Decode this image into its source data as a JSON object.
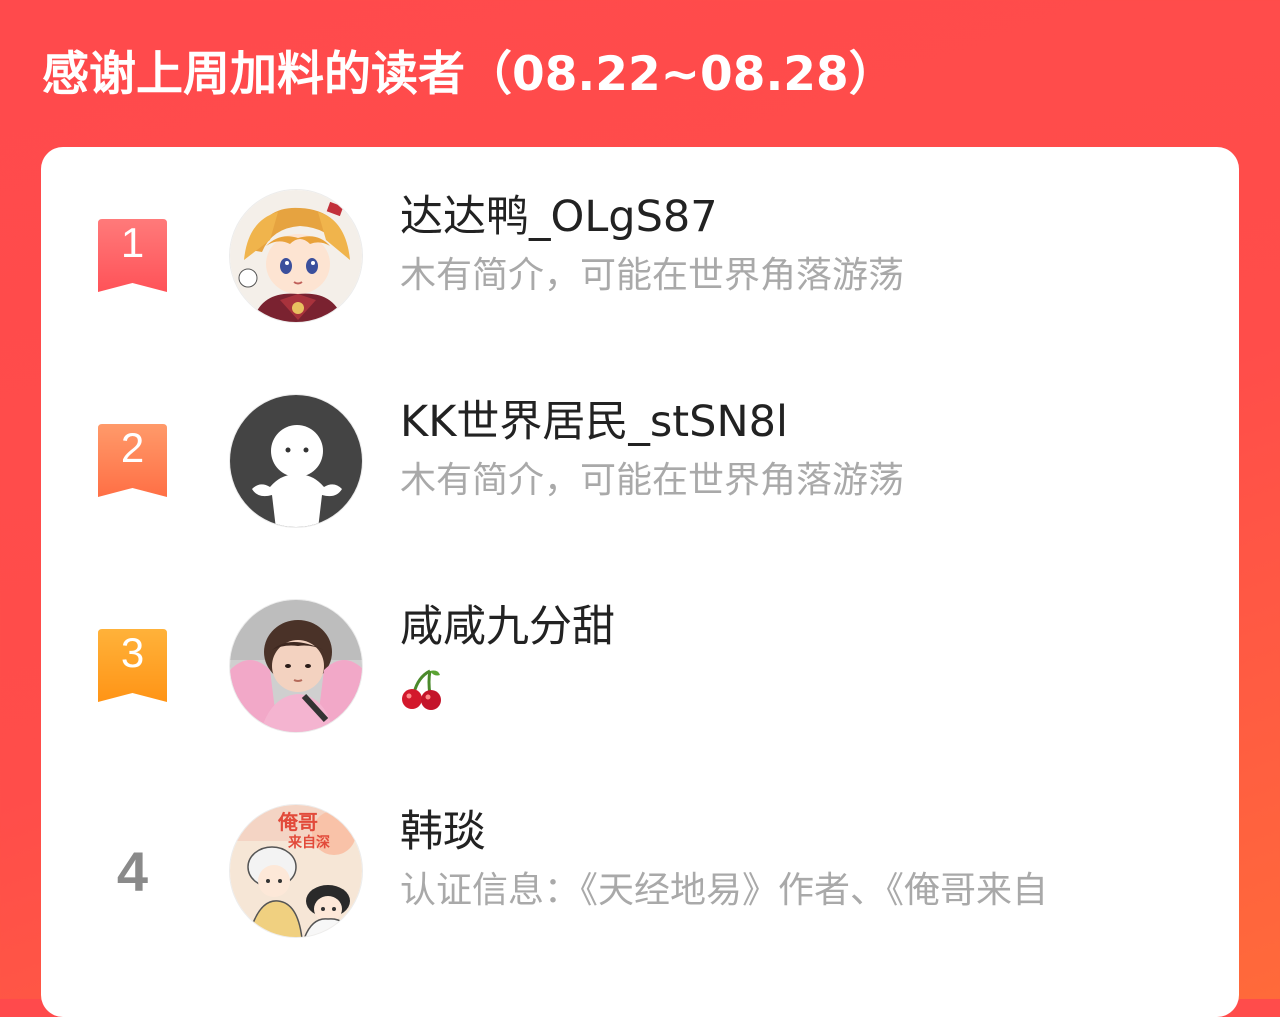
{
  "header": {
    "title": "感谢上周加料的读者（08.22~08.28）"
  },
  "colors": {
    "background": "#ff4a4c",
    "rank1": "#ff5a5f",
    "rank2": "#ff7a45",
    "rank3": "#ff9a1e",
    "rank_plain": "#8a8a8a",
    "name_text": "#222222",
    "bio_text": "#a9a9a9"
  },
  "readers": [
    {
      "rank": "1",
      "name": "达达鸭_OLgS87",
      "bio": "木有简介，可能在世界角落游荡",
      "avatar": "anime-boy-avatar-icon"
    },
    {
      "rank": "2",
      "name": "KK世界居民_stSN8l",
      "bio": "木有简介，可能在世界角落游荡",
      "avatar": "default-user-avatar-icon"
    },
    {
      "rank": "3",
      "name": "咸咸九分甜",
      "bio": "🍒",
      "avatar": "child-photo-avatar-icon"
    },
    {
      "rank": "4",
      "name": "韩琰",
      "bio": "认证信息：《天经地易》作者、《俺哥来自",
      "avatar": "comic-cover-avatar-icon"
    }
  ]
}
